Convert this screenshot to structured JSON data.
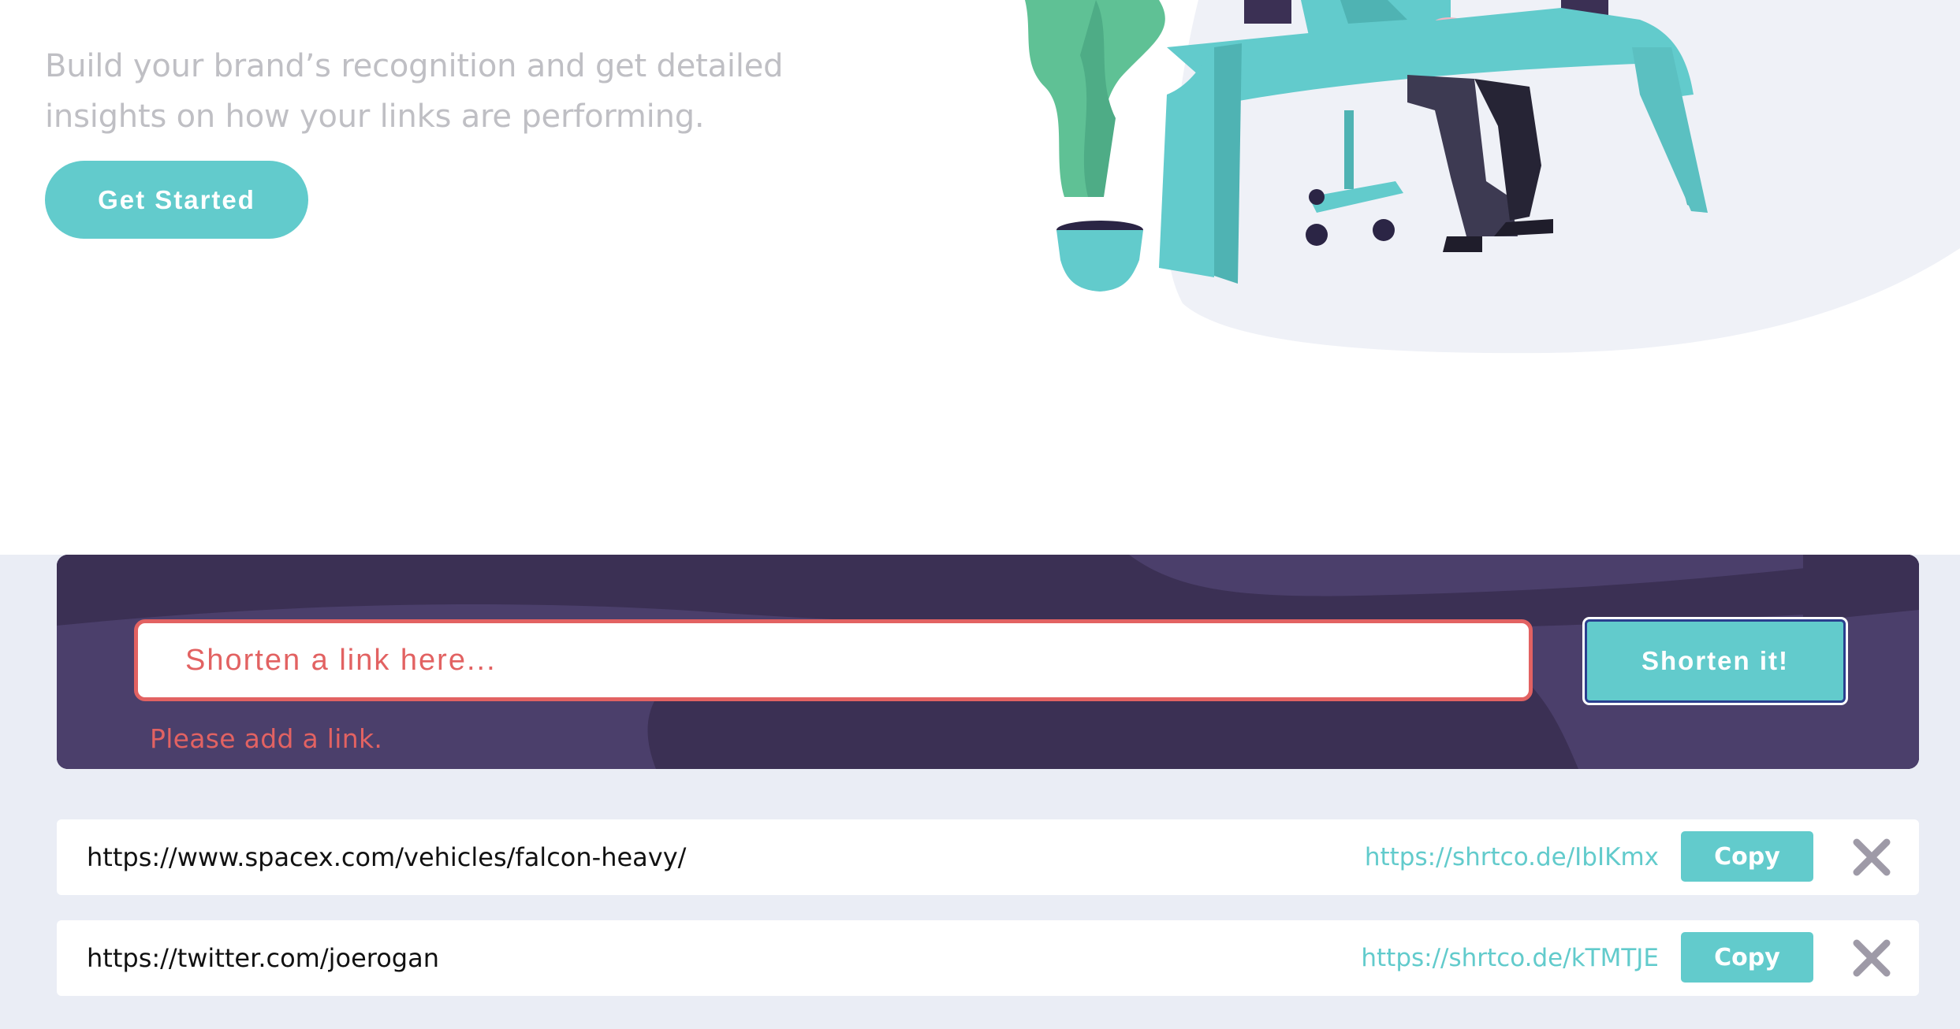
{
  "hero": {
    "description_line1": "Build your brand’s recognition and get detailed",
    "description_line2": "insights on how your links are performing.",
    "cta_label": "Get Started"
  },
  "shortener": {
    "input_placeholder": "Shorten a link here...",
    "input_value": "",
    "submit_label": "Shorten it!",
    "error_message": "Please add a link."
  },
  "results": [
    {
      "original": "https://www.spacex.com/vehicles/falcon-heavy/",
      "short": "https://shrtco.de/IbIKmx",
      "copy_label": "Copy",
      "remove_icon": "close-icon"
    },
    {
      "original": "https://twitter.com/joerogan",
      "short": "https://shrtco.de/kTMTJE",
      "copy_label": "Copy",
      "remove_icon": "close-icon"
    }
  ],
  "colors": {
    "cyan": "#62cbcc",
    "dark_violet": "#3b3054",
    "error_red": "#e26262",
    "muted_gray": "#bfbfc4",
    "section_bg": "#eaedf5"
  }
}
